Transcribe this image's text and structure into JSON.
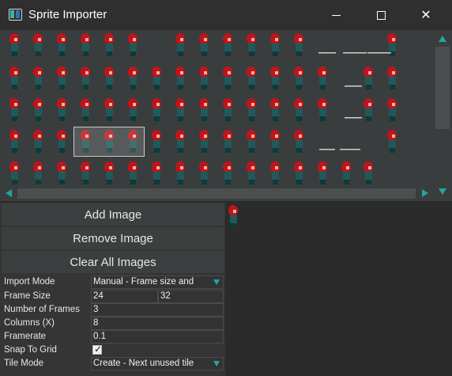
{
  "window": {
    "title": "Sprite Importer",
    "minimize_glyph": "—",
    "maximize_glyph": "☐",
    "close_glyph": "✕"
  },
  "sprite_sheet": {
    "icon": "sprite-character-icon",
    "colors": {
      "hair": "#c0141c",
      "body": "#1e5a5a",
      "background": "#3a3d3d",
      "accent": "#1fa7a0"
    }
  },
  "buttons": {
    "add_image": "Add Image",
    "remove_image": "Remove Image",
    "clear_all_images": "Clear All Images"
  },
  "properties": {
    "import_mode": {
      "label": "Import Mode",
      "value": "Manual - Frame size and"
    },
    "frame_size": {
      "label": "Frame Size",
      "width": "24",
      "height": "32"
    },
    "number_of_frames": {
      "label": "Number of Frames",
      "value": "3"
    },
    "columns": {
      "label": "Columns (X)",
      "value": "8"
    },
    "framerate": {
      "label": "Framerate",
      "value": "0.1"
    },
    "snap_to_grid": {
      "label": "Snap To Grid",
      "checked": true,
      "glyph": "✓"
    },
    "tile_mode": {
      "label": "Tile Mode",
      "value": "Create - Next unused tile"
    }
  }
}
